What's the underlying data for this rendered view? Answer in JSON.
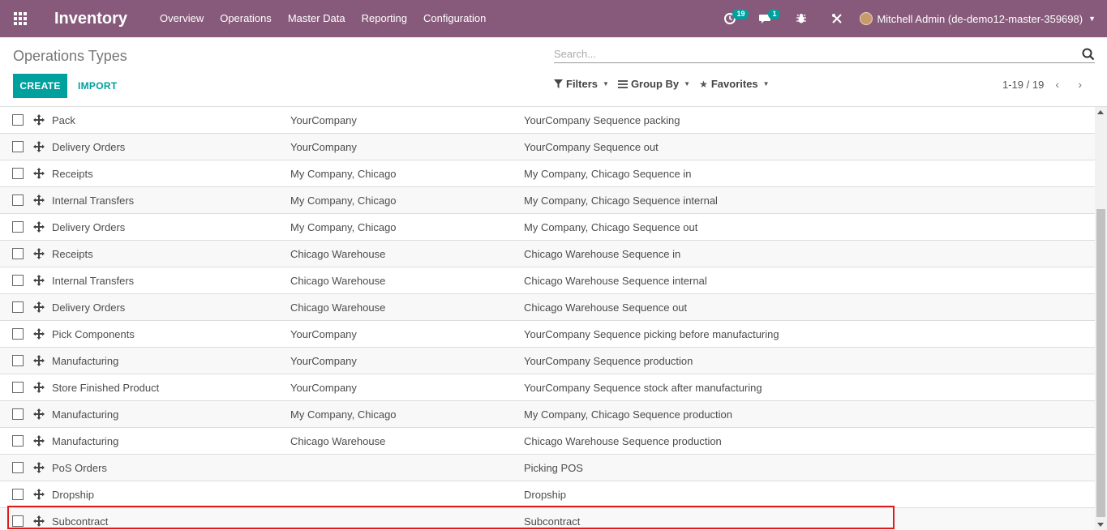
{
  "navbar": {
    "app_title": "Inventory",
    "menu": [
      "Overview",
      "Operations",
      "Master Data",
      "Reporting",
      "Configuration"
    ],
    "activity_count": "19",
    "messages_count": "1",
    "user_name": "Mitchell Admin (de-demo12-master-359698)",
    "bar_color": "#875A7B"
  },
  "control_panel": {
    "breadcrumb": "Operations Types",
    "search_placeholder": "Search...",
    "create_label": "CREATE",
    "import_label": "IMPORT",
    "filters_label": "Filters",
    "group_by_label": "Group By",
    "favorites_label": "Favorites",
    "pager_value": "1-19 / 19",
    "accent": "#00A09D"
  },
  "rows": [
    {
      "name": "Pack",
      "warehouse": "YourCompany",
      "sequence": "YourCompany Sequence packing"
    },
    {
      "name": "Delivery Orders",
      "warehouse": "YourCompany",
      "sequence": "YourCompany Sequence out"
    },
    {
      "name": "Receipts",
      "warehouse": "My Company, Chicago",
      "sequence": "My Company, Chicago Sequence in"
    },
    {
      "name": "Internal Transfers",
      "warehouse": "My Company, Chicago",
      "sequence": "My Company, Chicago Sequence internal"
    },
    {
      "name": "Delivery Orders",
      "warehouse": "My Company, Chicago",
      "sequence": "My Company, Chicago Sequence out"
    },
    {
      "name": "Receipts",
      "warehouse": "Chicago Warehouse",
      "sequence": "Chicago Warehouse Sequence in"
    },
    {
      "name": "Internal Transfers",
      "warehouse": "Chicago Warehouse",
      "sequence": "Chicago Warehouse Sequence internal"
    },
    {
      "name": "Delivery Orders",
      "warehouse": "Chicago Warehouse",
      "sequence": "Chicago Warehouse Sequence out"
    },
    {
      "name": "Pick Components",
      "warehouse": "YourCompany",
      "sequence": "YourCompany Sequence picking before manufacturing"
    },
    {
      "name": "Manufacturing",
      "warehouse": "YourCompany",
      "sequence": "YourCompany Sequence production"
    },
    {
      "name": "Store Finished Product",
      "warehouse": "YourCompany",
      "sequence": "YourCompany Sequence stock after manufacturing"
    },
    {
      "name": "Manufacturing",
      "warehouse": "My Company, Chicago",
      "sequence": "My Company, Chicago Sequence production"
    },
    {
      "name": "Manufacturing",
      "warehouse": "Chicago Warehouse",
      "sequence": "Chicago Warehouse Sequence production"
    },
    {
      "name": "PoS Orders",
      "warehouse": "",
      "sequence": "Picking POS"
    },
    {
      "name": "Dropship",
      "warehouse": "",
      "sequence": "Dropship"
    },
    {
      "name": "Subcontract",
      "warehouse": "",
      "sequence": "Subcontract"
    }
  ],
  "highlight_color": "#e01b1b"
}
